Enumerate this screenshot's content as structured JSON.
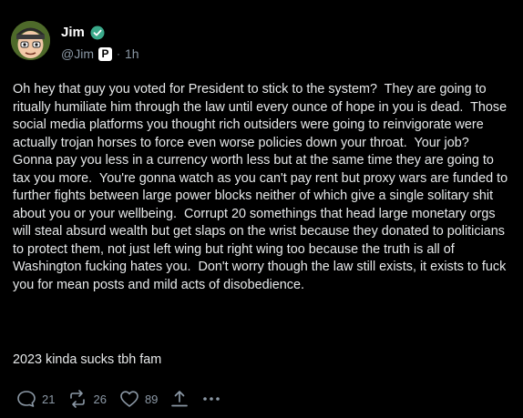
{
  "author": {
    "name": "Jim",
    "handle": "@Jim",
    "time": "1h",
    "dot": "·",
    "badge_letter": "P"
  },
  "post": {
    "body": "Oh hey that guy you voted for President to stick to the system?  They are going to ritually humiliate him through the law until every ounce of hope in you is dead.  Those social media platforms you thought rich outsiders were going to reinvigorate were actually trojan horses to force even worse policies down your throat.  Your job?  Gonna pay you less in a currency worth less but at the same time they are going to tax you more.  You're gonna watch as you can't pay rent but proxy wars are funded to further fights between large power blocks neither of which give a single solitary shit about you or your wellbeing.  Corrupt 20 somethings that head large monetary orgs will steal absurd wealth but get slaps on the wrist because they donated to politicians to protect them, not just left wing but right wing too because the truth is all of Washington fucking hates you.  Don't worry though the law still exists, it exists to fuck you for mean posts and mild acts of disobedience.",
    "closing": "2023 kinda sucks tbh fam"
  },
  "actions": {
    "replies": "21",
    "reposts": "26",
    "likes": "89"
  },
  "colors": {
    "background": "#000000",
    "text": "#e7e9ea",
    "muted": "#8b98a5",
    "verified": "#3aa98a"
  },
  "icons": [
    "avatar-face",
    "verified-check-icon",
    "p-badge-icon",
    "reply-icon",
    "repost-icon",
    "like-icon",
    "share-icon",
    "more-icon"
  ]
}
